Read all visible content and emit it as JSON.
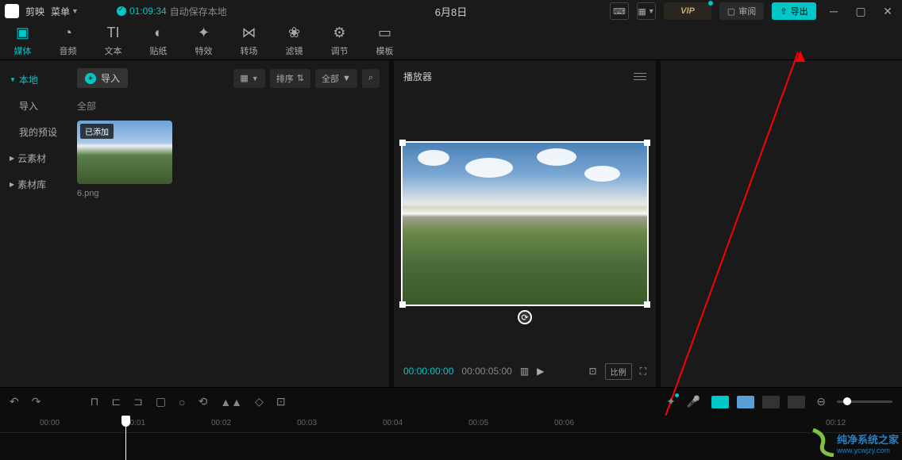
{
  "app": {
    "name": "剪映",
    "menu": "菜单"
  },
  "save": {
    "time": "01:09:34",
    "text": "自动保存本地"
  },
  "title": "6月8日",
  "top": {
    "review": "审阅",
    "export": "导出",
    "vip": "VIP"
  },
  "tabs": [
    {
      "icon": "▣",
      "label": "媒体"
    },
    {
      "icon": "◔",
      "label": "音频"
    },
    {
      "icon": "TI",
      "label": "文本"
    },
    {
      "icon": "◐",
      "label": "贴纸"
    },
    {
      "icon": "✦",
      "label": "特效"
    },
    {
      "icon": "⋈",
      "label": "转场"
    },
    {
      "icon": "❀",
      "label": "滤镜"
    },
    {
      "icon": "⚙",
      "label": "调节"
    },
    {
      "icon": "▭",
      "label": "模板"
    }
  ],
  "sidebar": [
    {
      "label": "本地",
      "caret": true,
      "active": true
    },
    {
      "label": "导入"
    },
    {
      "label": "我的预设"
    },
    {
      "label": "云素材",
      "caret": true
    },
    {
      "label": "素材库",
      "caret": true
    }
  ],
  "media": {
    "import": "导入",
    "sort": "排序",
    "all": "全部",
    "section": "全部",
    "thumb": {
      "badge": "已添加",
      "name": "6.png"
    }
  },
  "player": {
    "title": "播放器",
    "current": "00:00:00:00",
    "duration": "00:00:05:00",
    "ratio": "比例"
  },
  "timeline": {
    "ticks": [
      "00:00",
      "00:01",
      "00:02",
      "00:03",
      "00:04",
      "00:05",
      "00:06",
      "00:12"
    ]
  },
  "watermark": {
    "line1": "纯净系统之家",
    "line2": "www.ycwjzy.com"
  }
}
